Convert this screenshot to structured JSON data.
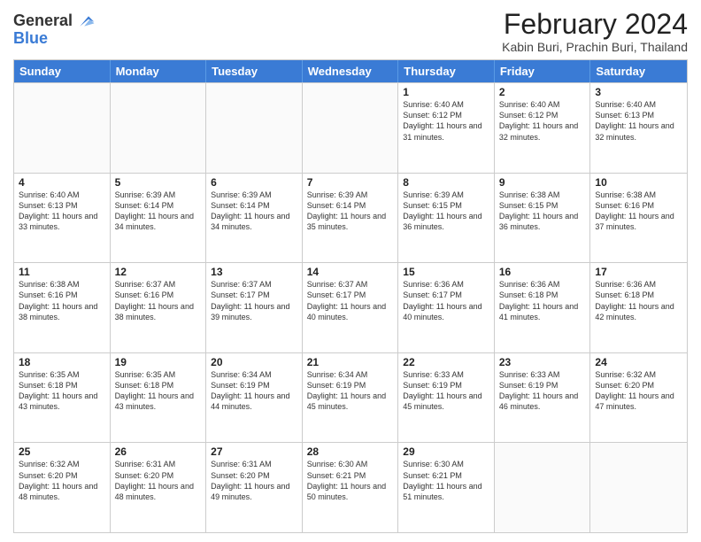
{
  "header": {
    "logo_line1": "General",
    "logo_line2": "Blue",
    "month_title": "February 2024",
    "location": "Kabin Buri, Prachin Buri, Thailand"
  },
  "days_of_week": [
    "Sunday",
    "Monday",
    "Tuesday",
    "Wednesday",
    "Thursday",
    "Friday",
    "Saturday"
  ],
  "weeks": [
    [
      {
        "day": "",
        "info": ""
      },
      {
        "day": "",
        "info": ""
      },
      {
        "day": "",
        "info": ""
      },
      {
        "day": "",
        "info": ""
      },
      {
        "day": "1",
        "info": "Sunrise: 6:40 AM\nSunset: 6:12 PM\nDaylight: 11 hours and 31 minutes."
      },
      {
        "day": "2",
        "info": "Sunrise: 6:40 AM\nSunset: 6:12 PM\nDaylight: 11 hours and 32 minutes."
      },
      {
        "day": "3",
        "info": "Sunrise: 6:40 AM\nSunset: 6:13 PM\nDaylight: 11 hours and 32 minutes."
      }
    ],
    [
      {
        "day": "4",
        "info": "Sunrise: 6:40 AM\nSunset: 6:13 PM\nDaylight: 11 hours and 33 minutes."
      },
      {
        "day": "5",
        "info": "Sunrise: 6:39 AM\nSunset: 6:14 PM\nDaylight: 11 hours and 34 minutes."
      },
      {
        "day": "6",
        "info": "Sunrise: 6:39 AM\nSunset: 6:14 PM\nDaylight: 11 hours and 34 minutes."
      },
      {
        "day": "7",
        "info": "Sunrise: 6:39 AM\nSunset: 6:14 PM\nDaylight: 11 hours and 35 minutes."
      },
      {
        "day": "8",
        "info": "Sunrise: 6:39 AM\nSunset: 6:15 PM\nDaylight: 11 hours and 36 minutes."
      },
      {
        "day": "9",
        "info": "Sunrise: 6:38 AM\nSunset: 6:15 PM\nDaylight: 11 hours and 36 minutes."
      },
      {
        "day": "10",
        "info": "Sunrise: 6:38 AM\nSunset: 6:16 PM\nDaylight: 11 hours and 37 minutes."
      }
    ],
    [
      {
        "day": "11",
        "info": "Sunrise: 6:38 AM\nSunset: 6:16 PM\nDaylight: 11 hours and 38 minutes."
      },
      {
        "day": "12",
        "info": "Sunrise: 6:37 AM\nSunset: 6:16 PM\nDaylight: 11 hours and 38 minutes."
      },
      {
        "day": "13",
        "info": "Sunrise: 6:37 AM\nSunset: 6:17 PM\nDaylight: 11 hours and 39 minutes."
      },
      {
        "day": "14",
        "info": "Sunrise: 6:37 AM\nSunset: 6:17 PM\nDaylight: 11 hours and 40 minutes."
      },
      {
        "day": "15",
        "info": "Sunrise: 6:36 AM\nSunset: 6:17 PM\nDaylight: 11 hours and 40 minutes."
      },
      {
        "day": "16",
        "info": "Sunrise: 6:36 AM\nSunset: 6:18 PM\nDaylight: 11 hours and 41 minutes."
      },
      {
        "day": "17",
        "info": "Sunrise: 6:36 AM\nSunset: 6:18 PM\nDaylight: 11 hours and 42 minutes."
      }
    ],
    [
      {
        "day": "18",
        "info": "Sunrise: 6:35 AM\nSunset: 6:18 PM\nDaylight: 11 hours and 43 minutes."
      },
      {
        "day": "19",
        "info": "Sunrise: 6:35 AM\nSunset: 6:18 PM\nDaylight: 11 hours and 43 minutes."
      },
      {
        "day": "20",
        "info": "Sunrise: 6:34 AM\nSunset: 6:19 PM\nDaylight: 11 hours and 44 minutes."
      },
      {
        "day": "21",
        "info": "Sunrise: 6:34 AM\nSunset: 6:19 PM\nDaylight: 11 hours and 45 minutes."
      },
      {
        "day": "22",
        "info": "Sunrise: 6:33 AM\nSunset: 6:19 PM\nDaylight: 11 hours and 45 minutes."
      },
      {
        "day": "23",
        "info": "Sunrise: 6:33 AM\nSunset: 6:19 PM\nDaylight: 11 hours and 46 minutes."
      },
      {
        "day": "24",
        "info": "Sunrise: 6:32 AM\nSunset: 6:20 PM\nDaylight: 11 hours and 47 minutes."
      }
    ],
    [
      {
        "day": "25",
        "info": "Sunrise: 6:32 AM\nSunset: 6:20 PM\nDaylight: 11 hours and 48 minutes."
      },
      {
        "day": "26",
        "info": "Sunrise: 6:31 AM\nSunset: 6:20 PM\nDaylight: 11 hours and 48 minutes."
      },
      {
        "day": "27",
        "info": "Sunrise: 6:31 AM\nSunset: 6:20 PM\nDaylight: 11 hours and 49 minutes."
      },
      {
        "day": "28",
        "info": "Sunrise: 6:30 AM\nSunset: 6:21 PM\nDaylight: 11 hours and 50 minutes."
      },
      {
        "day": "29",
        "info": "Sunrise: 6:30 AM\nSunset: 6:21 PM\nDaylight: 11 hours and 51 minutes."
      },
      {
        "day": "",
        "info": ""
      },
      {
        "day": "",
        "info": ""
      }
    ]
  ]
}
